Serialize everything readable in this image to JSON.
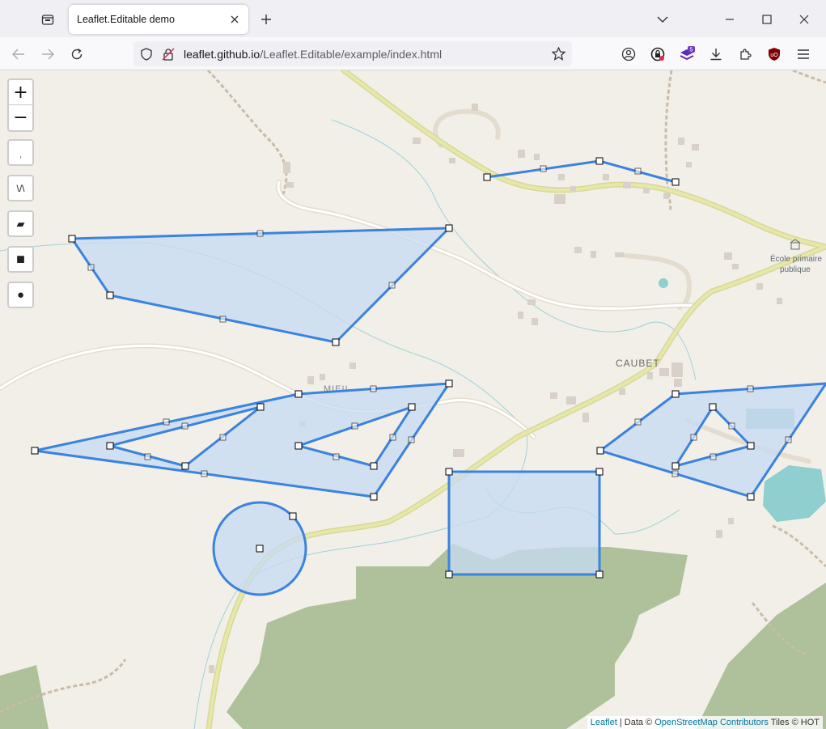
{
  "browser": {
    "tab_title": "Leaflet.Editable demo",
    "url_host": "leaflet.github.io",
    "url_path": "/Leaflet.Editable/example/index.html",
    "extension_badge": "5"
  },
  "map": {
    "zoom_in": "+",
    "zoom_out": "−",
    "tools": {
      "marker": "⸒",
      "polyline": "\\/\\",
      "polygon": "▰",
      "rectangle": "■",
      "circle": "●"
    },
    "labels": {
      "place_caubet": "CAUBET",
      "place_mieil": "MIEIL",
      "school_line1": "École primaire",
      "school_line2": "publique"
    },
    "attribution": {
      "leaflet": "Leaflet",
      "sep1": " | Data © ",
      "osm": "OpenStreetMap Contributors",
      "tiles": " Tiles © HOT"
    }
  },
  "colors": {
    "edit_stroke": "#3a83de",
    "edit_fill": "#c6dbf3",
    "forest": "#aec19a",
    "road_primary": "#dfe0a2",
    "water_line": "#9fd3d3",
    "lake": "#8fcfcf"
  }
}
